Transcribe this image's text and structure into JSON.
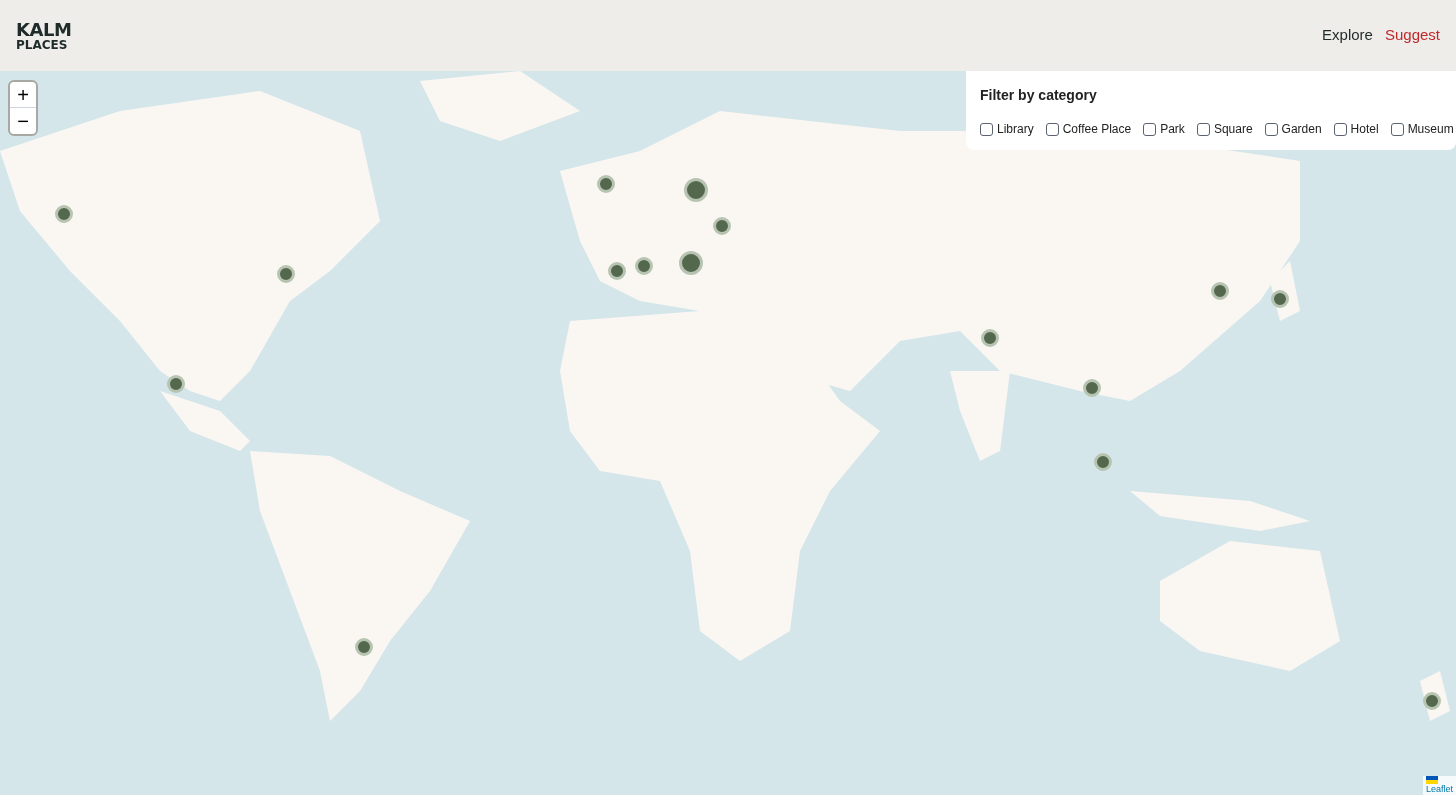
{
  "header": {
    "logo": [
      "KALM",
      "PLACES"
    ],
    "nav": [
      {
        "label": "Explore",
        "selected": true
      },
      {
        "label": "Suggest",
        "selected": false
      }
    ]
  },
  "map": {
    "zoom_in": "+",
    "zoom_out": "−",
    "attribution": "Leaflet",
    "markers": [
      {
        "kind": "small"
      },
      {
        "kind": "small"
      },
      {
        "kind": "small"
      },
      {
        "kind": "small"
      },
      {
        "kind": "small"
      },
      {
        "kind": "large"
      },
      {
        "kind": "small"
      },
      {
        "kind": "small"
      },
      {
        "kind": "small"
      },
      {
        "kind": "large"
      },
      {
        "kind": "small"
      },
      {
        "kind": "small"
      },
      {
        "kind": "small"
      },
      {
        "kind": "small"
      },
      {
        "kind": "small"
      },
      {
        "kind": "small"
      }
    ]
  },
  "filter": {
    "title": "Filter by category",
    "categories": [
      {
        "label": "Library",
        "checked": false
      },
      {
        "label": "Coffee Place",
        "checked": false
      },
      {
        "label": "Park",
        "checked": false
      },
      {
        "label": "Square",
        "checked": false
      },
      {
        "label": "Garden",
        "checked": false
      },
      {
        "label": "Hotel",
        "checked": false
      },
      {
        "label": "Museum",
        "checked": false
      }
    ]
  }
}
